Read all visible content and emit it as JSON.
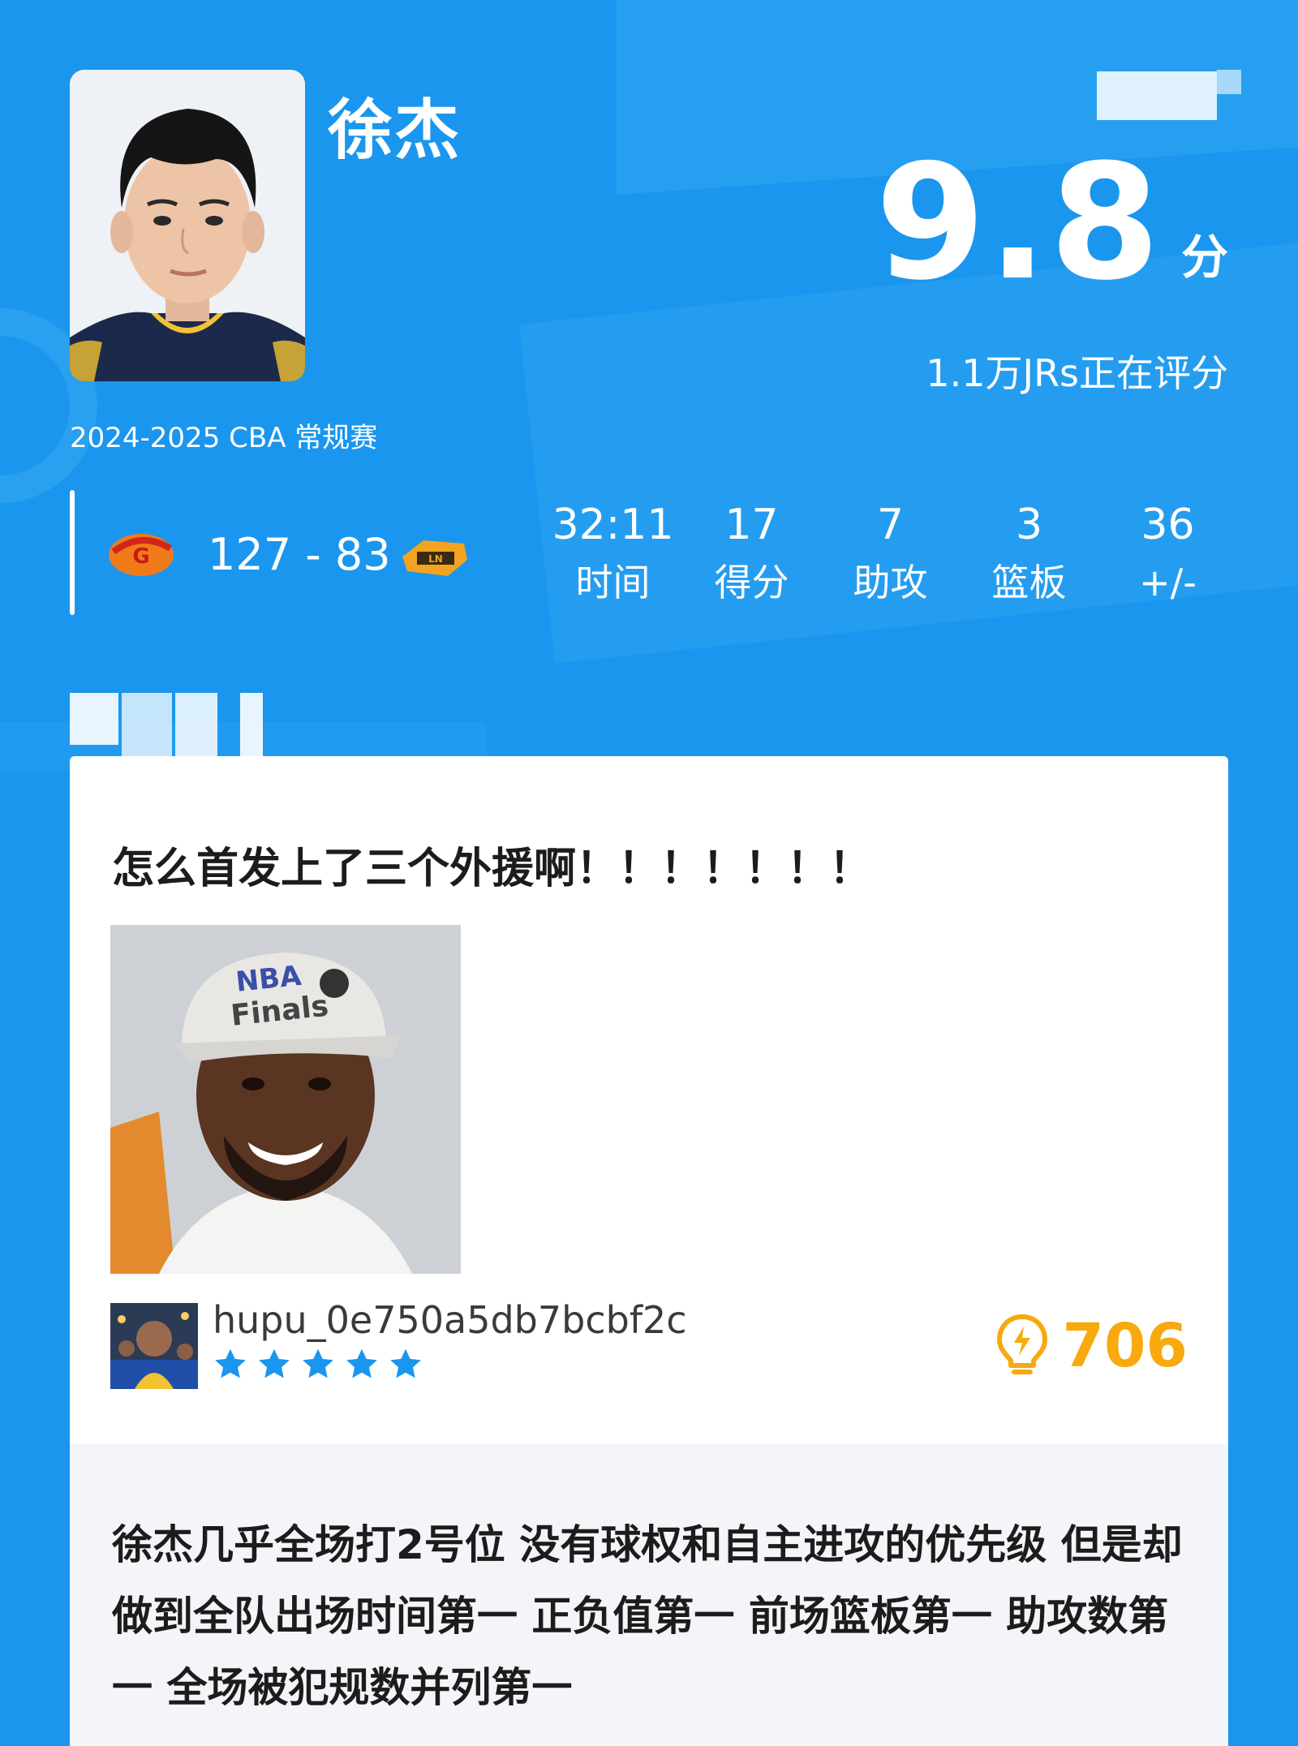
{
  "player": {
    "name": "徐杰",
    "season": "2024-2025 CBA 常规赛",
    "rating_value": "9.8",
    "rating_unit": "分",
    "raters": "1.1万JRs正在评分"
  },
  "game": {
    "score": "127 - 83",
    "stats": [
      {
        "value": "32:11",
        "label": "时间"
      },
      {
        "value": "17",
        "label": "得分"
      },
      {
        "value": "7",
        "label": "助攻"
      },
      {
        "value": "3",
        "label": "篮板"
      },
      {
        "value": "36",
        "label": "+/-"
      }
    ]
  },
  "comment": {
    "title": "怎么首发上了三个外援啊！！！！！！！",
    "username": "hupu_0e750a5db7bcbf2c",
    "stars": 5,
    "likes": "706",
    "reply": "徐杰几乎全场打2号位 没有球权和自主进攻的优先级 但是却做到全队出场时间第一 正负值第一 前场篮板第一 助攻数第一 全场被犯规数并列第一"
  },
  "colors": {
    "background": "#1a96ee",
    "star": "#1a96ee",
    "like": "#f7a90e"
  },
  "icons": [
    "lightbulb-icon",
    "star-icon",
    "team-logo-home",
    "team-logo-away",
    "cap-finals-text"
  ]
}
